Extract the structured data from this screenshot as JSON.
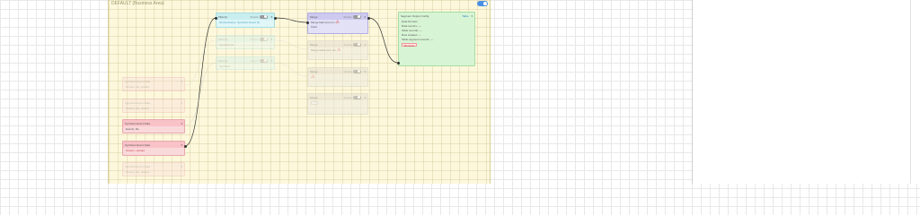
{
  "zone": {
    "title": "DEFAULT (Business Area)"
  },
  "sources": [
    {
      "title": "Synthetic Event Data",
      "detail": "Stream, file, upload"
    },
    {
      "title": "Synthetic Event Data",
      "detail": "Stream, file, upload"
    },
    {
      "title": "Synthetic Event Data",
      "detail": "Events, file"
    },
    {
      "title": "Synthetic Event Data",
      "detail": "Stream, Upload"
    },
    {
      "title": "Synthetic Event Data",
      "detail": "Stream, file, upload"
    }
  ],
  "filters": [
    {
      "title": "Filter(s)",
      "mode": "Simple",
      "detail": "All (Synthetic), Synthetic Event ID"
    },
    {
      "title": "Filter(s)",
      "mode": "Simple",
      "detail": "Synthetic ID"
    },
    {
      "title": "Filter(s)",
      "mode": "Simple",
      "detail": "Synthetic"
    }
  ],
  "merges": [
    {
      "title": "Merge",
      "mode": "Simple",
      "detail": "Merge field (sm) sm",
      "extra": "Field"
    },
    {
      "title": "Merge",
      "mode": "Simple",
      "detail": "Merge fields (sm) sm",
      "extra": ""
    },
    {
      "title": "Merge",
      "mode": "Simple",
      "detail": "",
      "extra": ""
    },
    {
      "title": "Merge",
      "mode": "Simple",
      "detail": "",
      "extra": ""
    }
  ],
  "destination": {
    "title": "Segment Output Config",
    "type": "Table",
    "lines": [
      "Data Domain",
      "Data country: —",
      "Table records: —",
      "Row created: —",
      "Table segment records: —"
    ],
    "delete_label": "Remove"
  },
  "icons": {
    "warning": "⚠",
    "chevron": "▾"
  }
}
